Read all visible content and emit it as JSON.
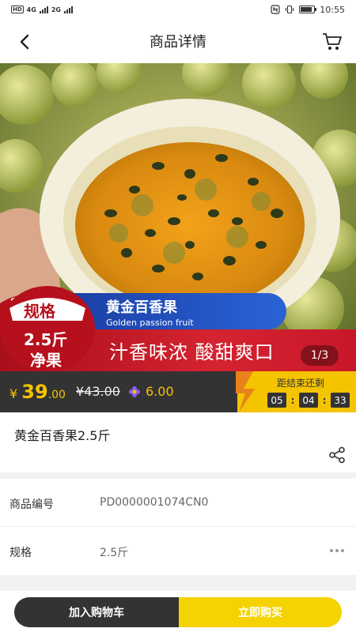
{
  "status_bar": {
    "network_1": "4G",
    "network_2": "2G",
    "time": "10:55",
    "battery_level": 0.85
  },
  "header": {
    "title": "商品详情",
    "back_icon": "chevron-left-icon",
    "cart_icon": "cart-icon"
  },
  "hero": {
    "spec_label": "规格",
    "spec_value": "2.5斤",
    "spec_net": "净果",
    "name_cn": "黄金百香果",
    "name_en": "Golden passion fruit",
    "slogan": "汁香味浓  酸甜爽口",
    "image_counter": "1/3"
  },
  "price_bar": {
    "currency": "¥",
    "price_int": "39",
    "price_dec": ".00",
    "original_price": "¥43.00",
    "points_value": "6.00",
    "points_icon": "flower-coin-icon",
    "countdown_label": "距结束还剩",
    "countdown": {
      "hours": "05",
      "minutes": "04",
      "seconds": "33"
    }
  },
  "product": {
    "name": "黄金百香果2.5斤",
    "share_icon": "share-icon"
  },
  "info": {
    "code_label": "商品编号",
    "code_value": "PD0000001074CN0",
    "spec_label": "规格",
    "spec_value": "2.5斤"
  },
  "bottom_bar": {
    "add_to_cart": "加入购物车",
    "buy_now": "立即购买"
  },
  "colors": {
    "accent_yellow": "#f5c400",
    "dark": "#333333",
    "red_band": "#d52330",
    "blue_pill": "#2a63d6"
  }
}
